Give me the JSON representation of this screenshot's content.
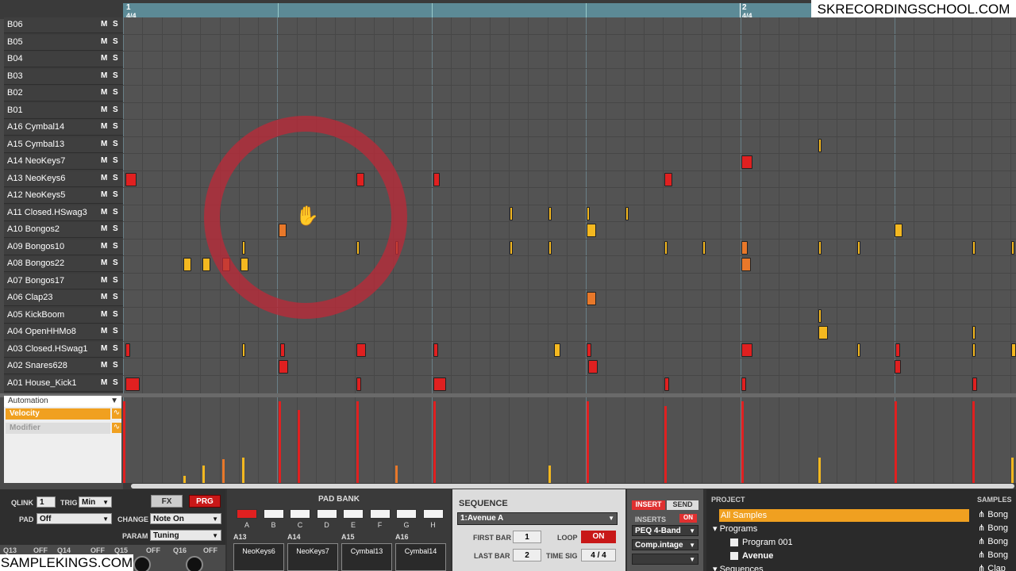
{
  "ruler": {
    "bar1": "1",
    "bar1_sig": "4/4",
    "bar2": "2",
    "bar2_sig": "4/4"
  },
  "watermark_top": "SKRECORDINGSCHOOL.COM",
  "watermark_bottom": "SAMPLEKINGS.COM",
  "tracks": [
    {
      "name": "B06",
      "m": "M",
      "s": "S"
    },
    {
      "name": "B05",
      "m": "M",
      "s": "S"
    },
    {
      "name": "B04",
      "m": "M",
      "s": "S"
    },
    {
      "name": "B03",
      "m": "M",
      "s": "S"
    },
    {
      "name": "B02",
      "m": "M",
      "s": "S"
    },
    {
      "name": "B01",
      "m": "M",
      "s": "S"
    },
    {
      "name": "A16  Cymbal14",
      "m": "M",
      "s": "S"
    },
    {
      "name": "A15  Cymbal13",
      "m": "M",
      "s": "S"
    },
    {
      "name": "A14  NeoKeys7",
      "m": "M",
      "s": "S"
    },
    {
      "name": "A13  NeoKeys6",
      "m": "M",
      "s": "S"
    },
    {
      "name": "A12  NeoKeys5",
      "m": "M",
      "s": "S"
    },
    {
      "name": "A11  Closed.HSwag3",
      "m": "M",
      "s": "S"
    },
    {
      "name": "A10  Bongos2",
      "m": "M",
      "s": "S"
    },
    {
      "name": "A09  Bongos10",
      "m": "M",
      "s": "S"
    },
    {
      "name": "A08  Bongos22",
      "m": "M",
      "s": "S"
    },
    {
      "name": "A07  Bongos17",
      "m": "M",
      "s": "S"
    },
    {
      "name": "A06  Clap23",
      "m": "M",
      "s": "S"
    },
    {
      "name": "A05  KickBoom",
      "m": "M",
      "s": "S"
    },
    {
      "name": "A04  OpenHHMo8",
      "m": "M",
      "s": "S"
    },
    {
      "name": "A03  Closed.HSwag1",
      "m": "M",
      "s": "S"
    },
    {
      "name": "A02  Snares628",
      "m": "M",
      "s": "S"
    },
    {
      "name": "A01  House_Kick1",
      "m": "M",
      "s": "S"
    }
  ],
  "automation": {
    "header": "Automation",
    "velocity": "Velocity",
    "modifier": "Modifier",
    "accent": "#f0a020"
  },
  "controls": {
    "qlink_label": "QLINK",
    "qlink_value": "1",
    "trig_label": "TRIG",
    "trig_value": "Min",
    "pad_label": "PAD",
    "pad_value": "Off",
    "fx": "FX",
    "prg": "PRG",
    "change_label": "CHANGE",
    "change_value": "Note On",
    "param_label": "PARAM",
    "param_value": "Tuning",
    "knob_labels": [
      "Q13",
      "OFF",
      "Q14",
      "OFF",
      "Q15",
      "OFF",
      "Q16",
      "OFF"
    ]
  },
  "padbank": {
    "title": "PAD BANK",
    "letters": [
      "A",
      "B",
      "C",
      "D",
      "E",
      "F",
      "G",
      "H"
    ],
    "active": "A",
    "slots": [
      {
        "id": "A13",
        "name": "NeoKeys6"
      },
      {
        "id": "A14",
        "name": "NeoKeys7"
      },
      {
        "id": "A15",
        "name": "Cymbal13"
      },
      {
        "id": "A16",
        "name": "Cymbal14"
      }
    ]
  },
  "sequence": {
    "title": "SEQUENCE",
    "name": "1:Avenue A",
    "first_bar_label": "FIRST BAR",
    "first_bar": "1",
    "last_bar_label": "LAST BAR",
    "last_bar": "2",
    "loop_label": "LOOP",
    "loop": "ON",
    "timesig_label": "TIME SIG",
    "timesig": "4 / 4"
  },
  "inserts": {
    "insert": "INSERT",
    "send": "SEND",
    "inserts_label": "INSERTS",
    "on": "ON",
    "slot1": "PEQ 4-Band",
    "slot2": "Comp.intage"
  },
  "project": {
    "title": "PROJECT",
    "samples_title": "SAMPLES",
    "all_samples": "All Samples",
    "programs": "Programs",
    "program1": "Program 001",
    "program2": "Avenue",
    "sequences": "Sequences",
    "samples": [
      "Bong",
      "Bong",
      "Bong",
      "Bong",
      "Clap"
    ]
  },
  "colors": {
    "red": "#e02020",
    "orange": "#e8782a",
    "yellow": "#f4b820",
    "ring": "#be2837"
  }
}
